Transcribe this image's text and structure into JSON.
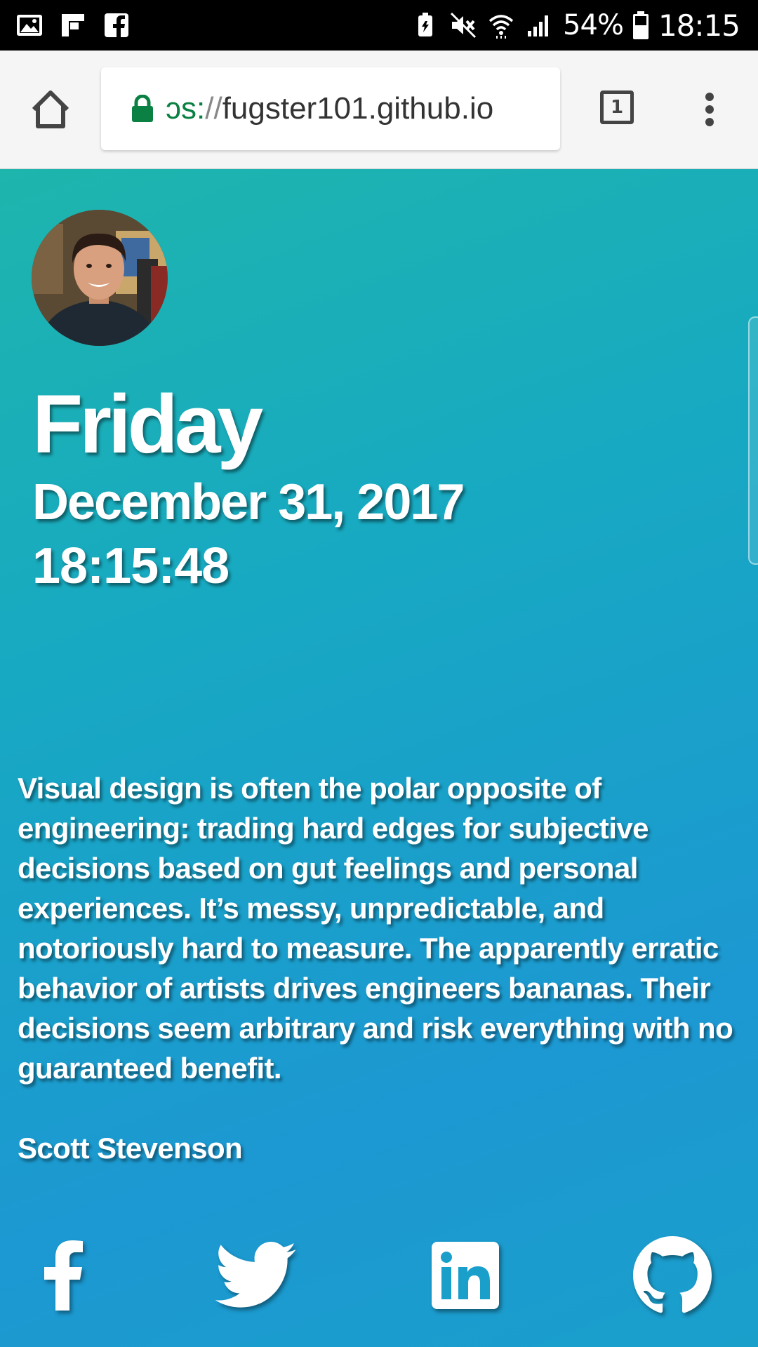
{
  "status_bar": {
    "battery": "54%",
    "clock": "18:15"
  },
  "browser": {
    "url_scheme": "ɔs:",
    "url_sep": "//",
    "url_host": "fugster101.github.io",
    "tab_count": "1"
  },
  "page": {
    "day": "Friday",
    "date": "December 31, 2017",
    "time": "18:15:48",
    "quote": "Visual design is often the polar opposite of engineering: trading hard edges for subjective decisions based on gut feelings and personal experiences. It’s messy, unpredictable, and notoriously hard to measure. The apparently erratic behavior of artists drives engineers bananas. Their decisions seem arbitrary and risk everything with no guaranteed benefit.",
    "author": "Scott Stevenson"
  },
  "social": [
    {
      "icon": "facebook-icon"
    },
    {
      "icon": "twitter-icon"
    },
    {
      "icon": "linkedin-icon"
    },
    {
      "icon": "github-icon"
    }
  ]
}
